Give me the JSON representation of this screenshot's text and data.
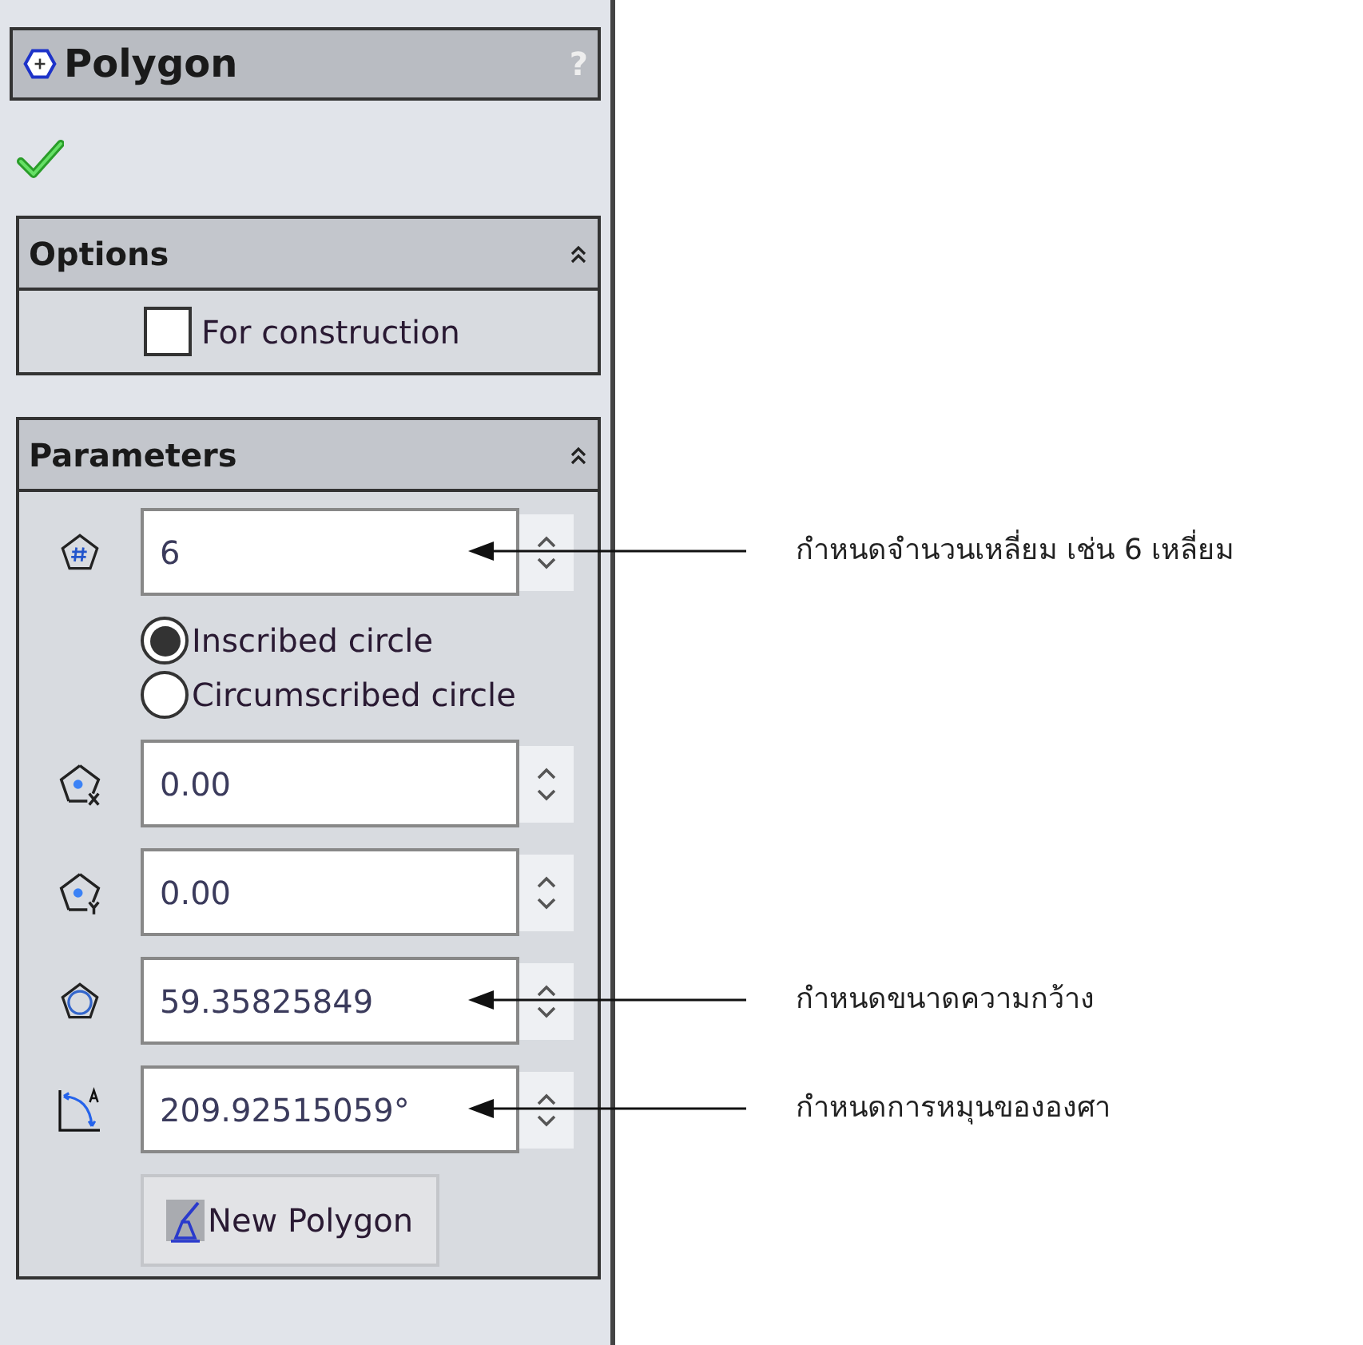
{
  "panel": {
    "title": "Polygon",
    "help": "?",
    "options": {
      "title": "Options",
      "checkbox": {
        "label": "For construction",
        "checked": false
      }
    },
    "parameters": {
      "title": "Parameters",
      "fields": [
        {
          "kind": "sides",
          "value": "6",
          "annotation": "กำหนดจำนวนเหลี่ยม เช่น 6 เหลี่ยม"
        },
        {
          "kind": "radio"
        },
        {
          "kind": "center_x",
          "value": "0.00"
        },
        {
          "kind": "center_y",
          "value": "0.00"
        },
        {
          "kind": "diameter",
          "value": "59.35825849",
          "annotation": "กำหนดขนาดความกว้าง"
        },
        {
          "kind": "angle",
          "value": "209.92515059°",
          "annotation": "กำหนดการหมุนขององศา"
        }
      ],
      "radios": [
        {
          "label": "Inscribed circle",
          "selected": true
        },
        {
          "label": "Circumscribed circle",
          "selected": false
        }
      ],
      "button": "New Polygon"
    }
  }
}
